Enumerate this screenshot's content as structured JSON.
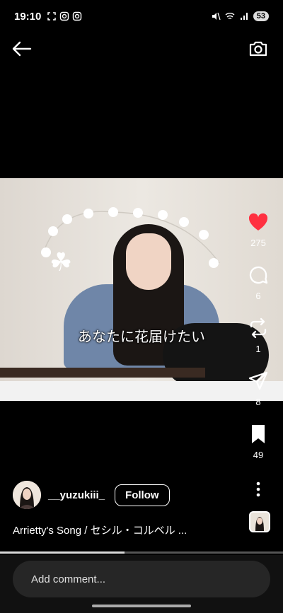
{
  "status_bar": {
    "time": "19:10",
    "battery": "53"
  },
  "video": {
    "lyric": "あなたに花届けたい"
  },
  "actions": {
    "likes": "275",
    "comments": "6",
    "reposts": "1",
    "shares": "8",
    "saves": "49"
  },
  "author": {
    "username": "__yuzukiii_",
    "follow_label": "Follow"
  },
  "caption": "Arrietty's Song / セシル・コルベル ...",
  "progress": 0.44,
  "comment": {
    "placeholder": "Add comment..."
  },
  "colors": {
    "like": "#ff3040",
    "background": "#000000",
    "input_bg": "#262626"
  }
}
